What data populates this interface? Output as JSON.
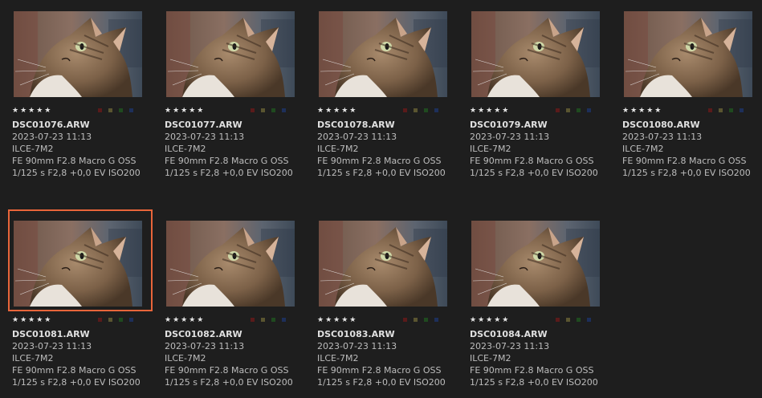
{
  "colors": {
    "background": "#1e1e1e",
    "selection_border": "#e8653a",
    "label_red": "#5a1a1a",
    "label_yellow": "#5a5530",
    "label_green": "#1f4a1f",
    "label_blue": "#1d2f5a"
  },
  "photos": [
    {
      "filename": "DSC01076.ARW",
      "datetime": "2023-07-23 11:13",
      "camera": "ILCE-7M2",
      "lens": "FE 90mm F2.8 Macro G OSS",
      "exposure": "1/125 s F2,8 +0,0 EV ISO200",
      "rating": "★★★★★",
      "selected": false
    },
    {
      "filename": "DSC01077.ARW",
      "datetime": "2023-07-23 11:13",
      "camera": "ILCE-7M2",
      "lens": "FE 90mm F2.8 Macro G OSS",
      "exposure": "1/125 s F2,8 +0,0 EV ISO200",
      "rating": "★★★★★",
      "selected": false
    },
    {
      "filename": "DSC01078.ARW",
      "datetime": "2023-07-23 11:13",
      "camera": "ILCE-7M2",
      "lens": "FE 90mm F2.8 Macro G OSS",
      "exposure": "1/125 s F2,8 +0,0 EV ISO200",
      "rating": "★★★★★",
      "selected": false
    },
    {
      "filename": "DSC01079.ARW",
      "datetime": "2023-07-23 11:13",
      "camera": "ILCE-7M2",
      "lens": "FE 90mm F2.8 Macro G OSS",
      "exposure": "1/125 s F2,8 +0,0 EV ISO200",
      "rating": "★★★★★",
      "selected": false
    },
    {
      "filename": "DSC01080.ARW",
      "datetime": "2023-07-23 11:13",
      "camera": "ILCE-7M2",
      "lens": "FE 90mm F2.8 Macro G OSS",
      "exposure": "1/125 s F2,8 +0,0 EV ISO200",
      "rating": "★★★★★",
      "selected": false
    },
    {
      "filename": "DSC01081.ARW",
      "datetime": "2023-07-23 11:13",
      "camera": "ILCE-7M2",
      "lens": "FE 90mm F2.8 Macro G OSS",
      "exposure": "1/125 s F2,8 +0,0 EV ISO200",
      "rating": "★★★★★",
      "selected": true
    },
    {
      "filename": "DSC01082.ARW",
      "datetime": "2023-07-23 11:13",
      "camera": "ILCE-7M2",
      "lens": "FE 90mm F2.8 Macro G OSS",
      "exposure": "1/125 s F2,8 +0,0 EV ISO200",
      "rating": "★★★★★",
      "selected": false
    },
    {
      "filename": "DSC01083.ARW",
      "datetime": "2023-07-23 11:13",
      "camera": "ILCE-7M2",
      "lens": "FE 90mm F2.8 Macro G OSS",
      "exposure": "1/125 s F2,8 +0,0 EV ISO200",
      "rating": "★★★★★",
      "selected": false
    },
    {
      "filename": "DSC01084.ARW",
      "datetime": "2023-07-23 11:13",
      "camera": "ILCE-7M2",
      "lens": "FE 90mm F2.8 Macro G OSS",
      "exposure": "1/125 s F2,8 +0,0 EV ISO200",
      "rating": "★★★★★",
      "selected": false
    }
  ]
}
